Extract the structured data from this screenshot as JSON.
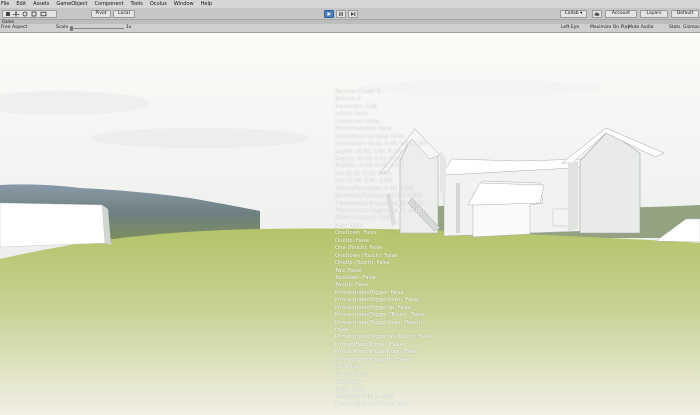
{
  "menu": [
    "File",
    "Edit",
    "Assets",
    "GameObject",
    "Component",
    "Tools",
    "Oculus",
    "Window",
    "Help"
  ],
  "toolbar": {
    "pivot_label": "Pivot",
    "local_label": "Local",
    "collab_label": "Collab ▾",
    "account_label": "Account",
    "layers_label": "Layers",
    "layout_label": "Default"
  },
  "tab": {
    "game_label": "Game"
  },
  "gamebar": {
    "aspect_label": "Free Aspect",
    "scale_label": "Scale",
    "scale_value": "1x",
    "eye_label": "Left Eye",
    "maximize_label": "Maximize On Play",
    "mute_label": "Mute Audio",
    "stats_label": "Stats",
    "gizmos_label": "Gizmos"
  },
  "debug_lines": [
    "RecenterCount: 0",
    "Battery: 0",
    "Framerate: 0.00",
    "Active: None",
    "Connected: None",
    "PrevConnected: None",
    "Controllers Changed: False",
    "Orientation: (0.00, 0.00, 0.00, 1.00)",
    "AngVel: (0.00, 0.00, 0.00)",
    "AngAcc: (0.00, 0.00, 0.00)",
    "Position: (0.00, 0.00, 0.00)",
    "Vel: (0.00, 0.00, 0.00)",
    "Acc: (0.00, 0.00, 0.00)",
    "PrimaryTouchpad: (0.00, 0.00)",
    "SecondaryTouchpad: (0.00, 0.00)",
    "PrimaryIndexTriggerAxis1D: (0.00)",
    "PrimaryIndexTriggerAxis1D: (0.00)",
    "WasRecentered: False",
    "One: False",
    "OneDown: False",
    "OneUp: False",
    "One (Touch): False",
    "OneDown (Touch): False",
    "OneUp (Touch): False",
    "Two: False",
    "TwoDown: False",
    "TwoUp: False",
    "PrimaryIndexTrigger: False",
    "PrimaryIndexTriggerDown: False",
    "PrimaryIndexTriggerUp: False",
    "PrimaryIndexTrigger (Touch): False",
    "PrimaryIndexTriggerDown (Touch):",
    "False",
    "PrimaryIndexTriggerUp (Touch): False",
    "PrimaryHandTrigger: False",
    "PrimaryHandTriggerDown: False",
    "PrimaryHandTriggerUp: False",
    "Up: False",
    "Down: False",
    "Left: False",
    "Right: False",
    "Touchpad (Click): False",
    "TouchpadDown (Click): False"
  ]
}
